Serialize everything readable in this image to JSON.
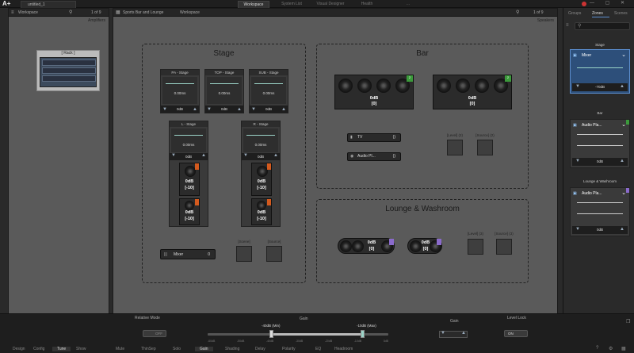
{
  "titlebar": {
    "logo": "A+",
    "file_tab": "untitled_1",
    "tabs": [
      "Workspace",
      "System List",
      "Visual Designer",
      "Health",
      "..."
    ],
    "window_controls": "— ▢ ✕"
  },
  "left_panel": {
    "header_dropdown": "Workspace",
    "header_counter": "1 of 9",
    "title": "Amplifiers",
    "rack_label": "[ Rack ]"
  },
  "center_panel": {
    "breadcrumb": "Sports Bar and Lounge",
    "header_dropdown": "Workspace",
    "header_counter": "1 of 9",
    "title": "Speakers"
  },
  "zones": {
    "stage": {
      "title": "Stage",
      "strips": [
        {
          "label": "PA - Stage",
          "delay": "0.00ms",
          "gain": "0dB"
        },
        {
          "label": "TOP - Stage",
          "delay": "0.00ms",
          "gain": "0dB"
        },
        {
          "label": "SUB - Stage",
          "delay": "0.00ms",
          "gain": "0dB"
        }
      ],
      "tall_strips": [
        {
          "label": "L - Stage",
          "delay": "0.00ms",
          "gain": "0dB",
          "spk": [
            {
              "db": "0dB",
              "sub": "[-10]"
            },
            {
              "db": "0dB",
              "sub": "[-10]"
            }
          ]
        },
        {
          "label": "R - Stage",
          "delay": "0.00ms",
          "gain": "0dB",
          "spk": [
            {
              "db": "0dB",
              "sub": "[-10]"
            },
            {
              "db": "0dB",
              "sub": "[-10]"
            }
          ]
        }
      ],
      "mixer_label": "Mixer",
      "mixer_value": "0",
      "scene_label": "[Scene]",
      "source_label": "[Source]"
    },
    "bar": {
      "title": "Bar",
      "arrays": [
        {
          "db": "0dB",
          "sub": "[0]",
          "badge": "2"
        },
        {
          "db": "0dB",
          "sub": "[0]",
          "badge": "2"
        }
      ],
      "tv_label": "TV",
      "tv_value": "()",
      "audio_label": "Audio Pl...",
      "audio_value": "()",
      "level_label": "[Level] (2)",
      "source_label": "[Source] (2)"
    },
    "lounge": {
      "title": "Lounge & Washroom",
      "groups": [
        {
          "db": "0dB",
          "sub": "[0]"
        },
        {
          "db": "0dB",
          "sub": "[0]"
        }
      ],
      "level_label": "[Level] (3)",
      "source_label": "[Source] (3)"
    }
  },
  "right_panel": {
    "tabs": [
      "Groups",
      "Zones",
      "Scenes"
    ],
    "search_placeholder": "",
    "cards": [
      {
        "section": "Stage",
        "name": "Mixer",
        "value": "-70dB",
        "selected": true
      },
      {
        "section": "Bar",
        "name": "Audio Pla...",
        "value": "0dB",
        "selected": false
      },
      {
        "section": "Lounge & Washroom",
        "name": "Audio Pla...",
        "value": "0dB",
        "selected": false
      }
    ]
  },
  "bottom": {
    "relative_mode_label": "Relative Mode",
    "relative_mode_state": "OFF",
    "gain_label": "Gain",
    "gain_min": "-40dB (Min)",
    "gain_max": "-10dB (Max)",
    "gain_ticks": [
      "-60dB",
      "-50dB",
      "-40dB",
      "-30dB",
      "-20dB",
      "-10dB",
      "0dB"
    ],
    "gain2_label": "Gain",
    "gain2_value": "",
    "level_lock_label": "Level Lock",
    "level_lock_state": "ON",
    "tabs": [
      "Design",
      "Config",
      "Tune",
      "Show",
      "Mute",
      "ThinSep",
      "Solo",
      "Gain",
      "Shading",
      "Delay",
      "Polarity",
      "EQ",
      "Headroom"
    ]
  },
  "colors": {
    "accent_blue": "#2d4f7a",
    "badge_green": "#3b9a3b",
    "badge_orange": "#d45a1e",
    "badge_purple": "#8a6acb",
    "meter_line": "#9bd4c8"
  }
}
